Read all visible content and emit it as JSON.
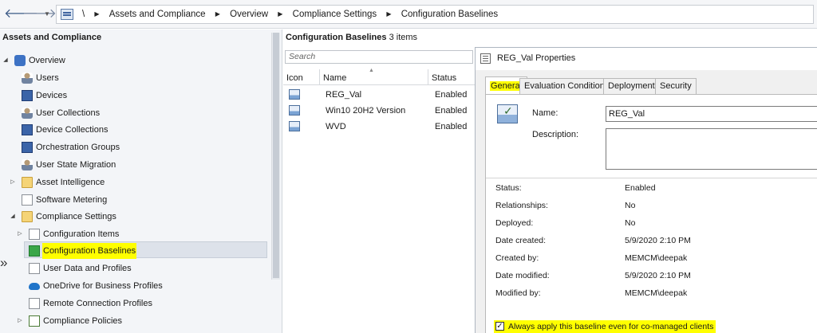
{
  "breadcrumb": {
    "root_sep": "\\",
    "items": [
      "Assets and Compliance",
      "Overview",
      "Compliance Settings",
      "Configuration Baselines"
    ]
  },
  "nav": {
    "title": "Assets and Compliance",
    "items": [
      {
        "label": "Overview",
        "icon": "overview-icon"
      },
      {
        "label": "Users",
        "icon": "users-icon"
      },
      {
        "label": "Devices",
        "icon": "devices-icon"
      },
      {
        "label": "User Collections",
        "icon": "user-collections-icon"
      },
      {
        "label": "Device Collections",
        "icon": "device-collections-icon"
      },
      {
        "label": "Orchestration Groups",
        "icon": "orchestration-groups-icon"
      },
      {
        "label": "User State Migration",
        "icon": "user-state-migration-icon"
      },
      {
        "label": "Asset Intelligence",
        "icon": "folder-icon"
      },
      {
        "label": "Software Metering",
        "icon": "software-metering-icon"
      },
      {
        "label": "Compliance Settings",
        "icon": "folder-icon"
      },
      {
        "label": "Configuration Items",
        "icon": "configuration-items-icon"
      },
      {
        "label": "Configuration Baselines",
        "icon": "configuration-baselines-icon"
      },
      {
        "label": "User Data and Profiles",
        "icon": "user-data-profiles-icon"
      },
      {
        "label": "OneDrive for Business Profiles",
        "icon": "onedrive-icon"
      },
      {
        "label": "Remote Connection Profiles",
        "icon": "remote-connection-icon"
      },
      {
        "label": "Compliance Policies",
        "icon": "compliance-policies-icon"
      }
    ]
  },
  "list": {
    "title_bold": "Configuration Baselines",
    "title_count": "3 items",
    "search_placeholder": "Search",
    "columns": [
      "Icon",
      "Name",
      "Status"
    ],
    "rows": [
      {
        "name": "REG_Val",
        "status": "Enabled"
      },
      {
        "name": "Win10 20H2 Version",
        "status": "Enabled"
      },
      {
        "name": "WVD",
        "status": "Enabled"
      }
    ]
  },
  "dialog": {
    "title": "REG_Val Properties",
    "tabs": [
      "General",
      "Evaluation Conditions",
      "Deployments",
      "Security"
    ],
    "name_label": "Name:",
    "name_value": "REG_Val",
    "description_label": "Description:",
    "properties": [
      {
        "label": "Status:",
        "value": "Enabled"
      },
      {
        "label": "Relationships:",
        "value": "No"
      },
      {
        "label": "Deployed:",
        "value": "No"
      },
      {
        "label": "Date created:",
        "value": "5/9/2020 2:10 PM"
      },
      {
        "label": "Created by:",
        "value": "MEMCM\\deepak"
      },
      {
        "label": "Date modified:",
        "value": "5/9/2020 2:10 PM"
      },
      {
        "label": "Modified by:",
        "value": "MEMCM\\deepak"
      }
    ],
    "checkbox_label": "Always apply this baseline even for co-managed clients",
    "checkbox_mark": "✓",
    "highlight_color": "#ffff00"
  }
}
